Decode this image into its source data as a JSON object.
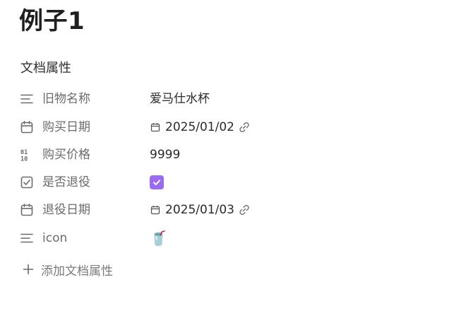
{
  "page": {
    "title": "例子1"
  },
  "properties_section": {
    "heading": "文档属性",
    "add_label": "添加文档属性",
    "items": [
      {
        "icon": "text-lines-icon",
        "name": "旧物名称",
        "type": "text",
        "value": "爱马仕水杯"
      },
      {
        "icon": "calendar-icon",
        "name": "购买日期",
        "type": "date",
        "value": "2025/01/02"
      },
      {
        "icon": "number-icon",
        "name": "购买价格",
        "type": "number",
        "value": "9999"
      },
      {
        "icon": "checkbox-icon",
        "name": "是否退役",
        "type": "checkbox",
        "checked": true
      },
      {
        "icon": "calendar-icon",
        "name": "退役日期",
        "type": "date",
        "value": "2025/01/03"
      },
      {
        "icon": "text-lines-icon",
        "name": "icon",
        "type": "text",
        "value": "🥤"
      }
    ]
  },
  "colors": {
    "checkbox_accent": "#9b6cf0",
    "icon_gray": "#6b6b6b"
  }
}
